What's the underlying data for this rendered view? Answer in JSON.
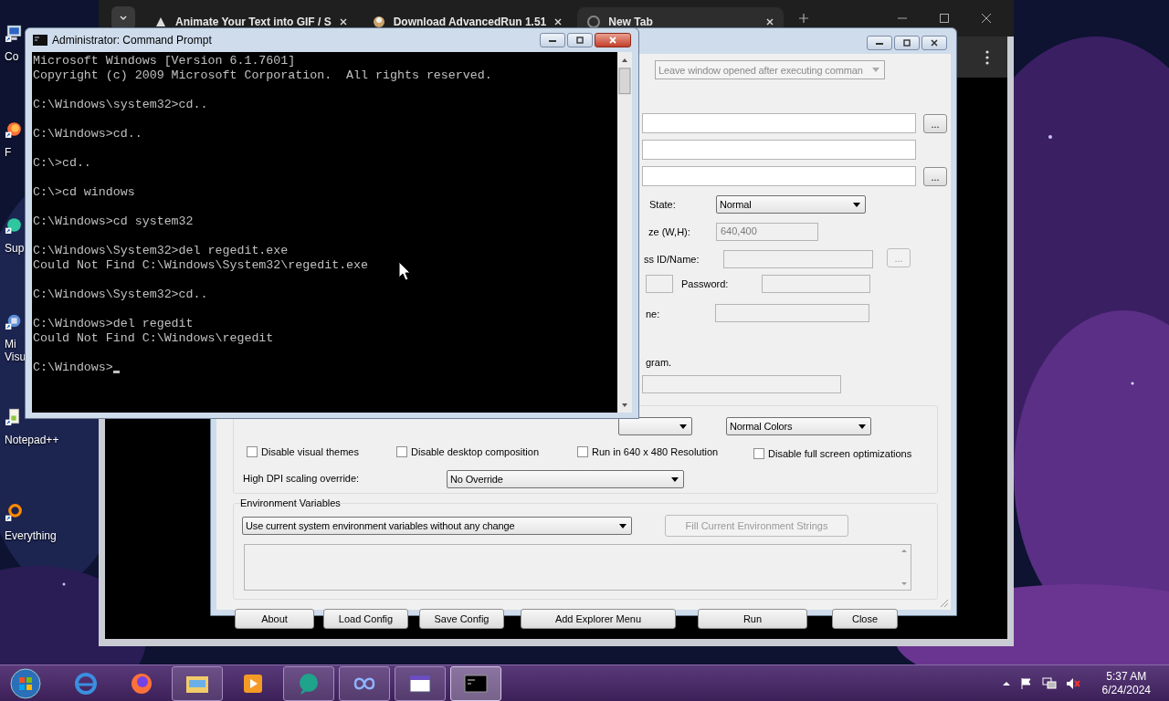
{
  "desktop": {
    "icons": [
      {
        "kind": "computer",
        "lines": [
          "Co"
        ]
      },
      {
        "kind": "firefox",
        "lines": [
          "F"
        ]
      },
      {
        "kind": "teal",
        "lines": [
          "Sup"
        ]
      },
      {
        "kind": "studio",
        "lines": [
          "Mi",
          "Visu"
        ]
      },
      {
        "kind": "notepad",
        "lines": [
          "Notepad++"
        ]
      },
      {
        "kind": "everything",
        "lines": [
          "Everything"
        ]
      }
    ]
  },
  "browser": {
    "tabs": [
      {
        "kind": "gif",
        "title": "Animate Your Text into GIF / S",
        "selected": false
      },
      {
        "kind": "download",
        "title": "Download AdvancedRun 1.51",
        "selected": false
      },
      {
        "kind": "globe",
        "title": "New Tab",
        "selected": true
      }
    ]
  },
  "advancedrun": {
    "run_mode": {
      "value": "Leave window opened after executing comman",
      "disabled": true
    },
    "file_rows": [
      {
        "browse_button": "..."
      },
      {},
      {
        "browse_button": "..."
      }
    ],
    "window_state": {
      "label": "State:",
      "value": "Normal"
    },
    "window_size": {
      "label": "ze (W,H):",
      "value": "640,400",
      "disabled": true
    },
    "process": {
      "label": "ss ID/Name:",
      "browse_button": "...",
      "disabled": true
    },
    "credentials": {
      "password_label": "Password:",
      "disabled": true
    },
    "name_row": {
      "label": "ne:",
      "disabled": true
    },
    "program_row": {
      "label": "gram.",
      "disabled": true
    },
    "compatibility": {
      "colors": "Normal Colors",
      "checkboxes": [
        {
          "label": "Disable visual themes",
          "checked": false
        },
        {
          "label": "Disable desktop composition",
          "checked": false
        },
        {
          "label": "Run in 640 x 480 Resolution",
          "checked": false
        },
        {
          "label": "Disable full screen optimizations",
          "checked": false
        }
      ],
      "dpi_label": "High DPI scaling override:",
      "dpi_value": "No Override"
    },
    "environment": {
      "title": "Environment Variables",
      "mode": "Use current system environment variables without any change",
      "fill_button": {
        "label": "Fill Current Environment Strings",
        "disabled": true
      }
    },
    "buttons": [
      "About",
      "Load Config",
      "Save Config",
      "Add Explorer Menu",
      "Run",
      "Close"
    ]
  },
  "cmd": {
    "title": "Administrator:  Command Prompt",
    "blocks": [
      [
        "Microsoft Windows [Version 6.1.7601]",
        "Copyright (c) 2009 Microsoft Corporation.  All rights reserved."
      ],
      [
        "C:\\Windows\\system32>cd.."
      ],
      [
        "C:\\Windows>cd.."
      ],
      [
        "C:\\>cd.."
      ],
      [
        "C:\\>cd windows"
      ],
      [
        "C:\\Windows>cd system32"
      ],
      [
        "C:\\Windows\\System32>del regedit.exe",
        "Could Not Find C:\\Windows\\System32\\regedit.exe"
      ],
      [
        "C:\\Windows\\System32>cd.."
      ],
      [
        "C:\\Windows>del regedit",
        "Could Not Find C:\\Windows\\regedit"
      ],
      [
        "C:\\Windows>"
      ]
    ]
  },
  "taskbar": {
    "apps": [
      {
        "kind": "ie",
        "running": false,
        "selected": false
      },
      {
        "kind": "firefox",
        "running": false,
        "selected": false
      },
      {
        "kind": "explorer",
        "running": true,
        "selected": false
      },
      {
        "kind": "media",
        "running": false,
        "selected": false
      },
      {
        "kind": "bubble",
        "running": true,
        "selected": false
      },
      {
        "kind": "infinity",
        "running": true,
        "selected": false
      },
      {
        "kind": "window",
        "running": true,
        "selected": false
      },
      {
        "kind": "cmd",
        "running": true,
        "selected": true
      }
    ],
    "clock": {
      "time": "5:37 AM",
      "date": "6/24/2024"
    }
  }
}
